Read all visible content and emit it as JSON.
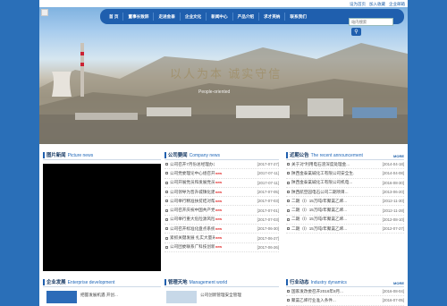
{
  "top_links": [
    "设为首页",
    "加入收藏",
    "企业邮箱"
  ],
  "nav": [
    "首 页",
    "董事长致辞",
    "走进金泰",
    "企业文化",
    "新闻中心",
    "产品介绍",
    "求才英纳",
    "联系我们"
  ],
  "search": {
    "placeholder": "站内搜索"
  },
  "banner": {
    "slogan": "以人为本  诚实守信",
    "slogan_en": "People-oriented"
  },
  "picture_news": {
    "title_cn": "图片新闻",
    "title_en": "Picture news"
  },
  "company_news": {
    "title_cn": "公司要闻",
    "title_en": "Company news",
    "more": "MORE",
    "items": [
      {
        "title": "公司召开7月份总经理办公",
        "new": "",
        "date": "[2017-07-27]"
      },
      {
        "title": "公司党委理论中心组召开2...",
        "new": "new",
        "date": "[2017-07-11]"
      },
      {
        "title": "公司开展党员和发展党员工...",
        "new": "new",
        "date": "[2017-07-11]"
      },
      {
        "title": "公司领导为晋升城镇化建设",
        "new": "new",
        "date": "[2017-07-05]"
      },
      {
        "title": "公司举行精准扶贫结对帮扶",
        "new": "new",
        "date": "[2017-07-03]"
      },
      {
        "title": "公司召开庆祝中国共产党成...",
        "new": "new",
        "date": "[2017-07-01]"
      },
      {
        "title": "公司举行重大危险源风险源...",
        "new": "new",
        "date": "[2017-07-03]"
      },
      {
        "title": "公司召开标准化盘点系统推进",
        "new": "new",
        "date": "[2017-06-30]"
      },
      {
        "title": "紧抓关键发展  扎实大量采",
        "new": "new",
        "date": "[2017-06-27]"
      },
      {
        "title": "公司团委联系广科技创新科",
        "new": "new",
        "date": "[2017-06-26]"
      }
    ]
  },
  "announcement": {
    "title_cn": "近期公告",
    "title_en": "The recent announcement",
    "more": "MORE",
    "items": [
      {
        "title": "关于对“利用电石渣深度处理金...",
        "date": "[2014-04-18]"
      },
      {
        "title": "陕西金泰氯碱化工有限公司安全生...",
        "date": "[2014-04-08]"
      },
      {
        "title": "陕西金泰氯碱化工有限公司机电...",
        "date": "[2016-08-30]"
      },
      {
        "title": "陕西航空园电石公司二期项目...",
        "date": "[2013-06-20]"
      },
      {
        "title": "二期（Ⅰ）15万吨/年聚氯乙烯...",
        "date": "[2012-11-30]"
      },
      {
        "title": "二期（Ⅰ）15万吨/年聚氯乙烯...",
        "date": "[2012-11-28]"
      },
      {
        "title": "二期（Ⅰ）15万吨/年聚氯乙烯...",
        "date": "[2012-08-10]"
      },
      {
        "title": "二期（Ⅰ）15万吨/年聚氯乙烯...",
        "date": "[2012-07-27]"
      }
    ]
  },
  "enterprise": {
    "title_cn": "企业发展",
    "title_en": "Enterprise development",
    "text": "把握发展机遇 开创..."
  },
  "management": {
    "title_cn": "管理天地",
    "title_en": "Management world",
    "text": "公司创新管理安全管理"
  },
  "industry": {
    "title_cn": "行业动态",
    "title_en": "Industry dynamics",
    "more": "MORE",
    "items": [
      {
        "title": "国家发改委召开2016年8月...",
        "date": "[2016-08-04]"
      },
      {
        "title": "聚氯乙烯行业准入条件...",
        "date": "[2016-07-05]"
      }
    ]
  }
}
